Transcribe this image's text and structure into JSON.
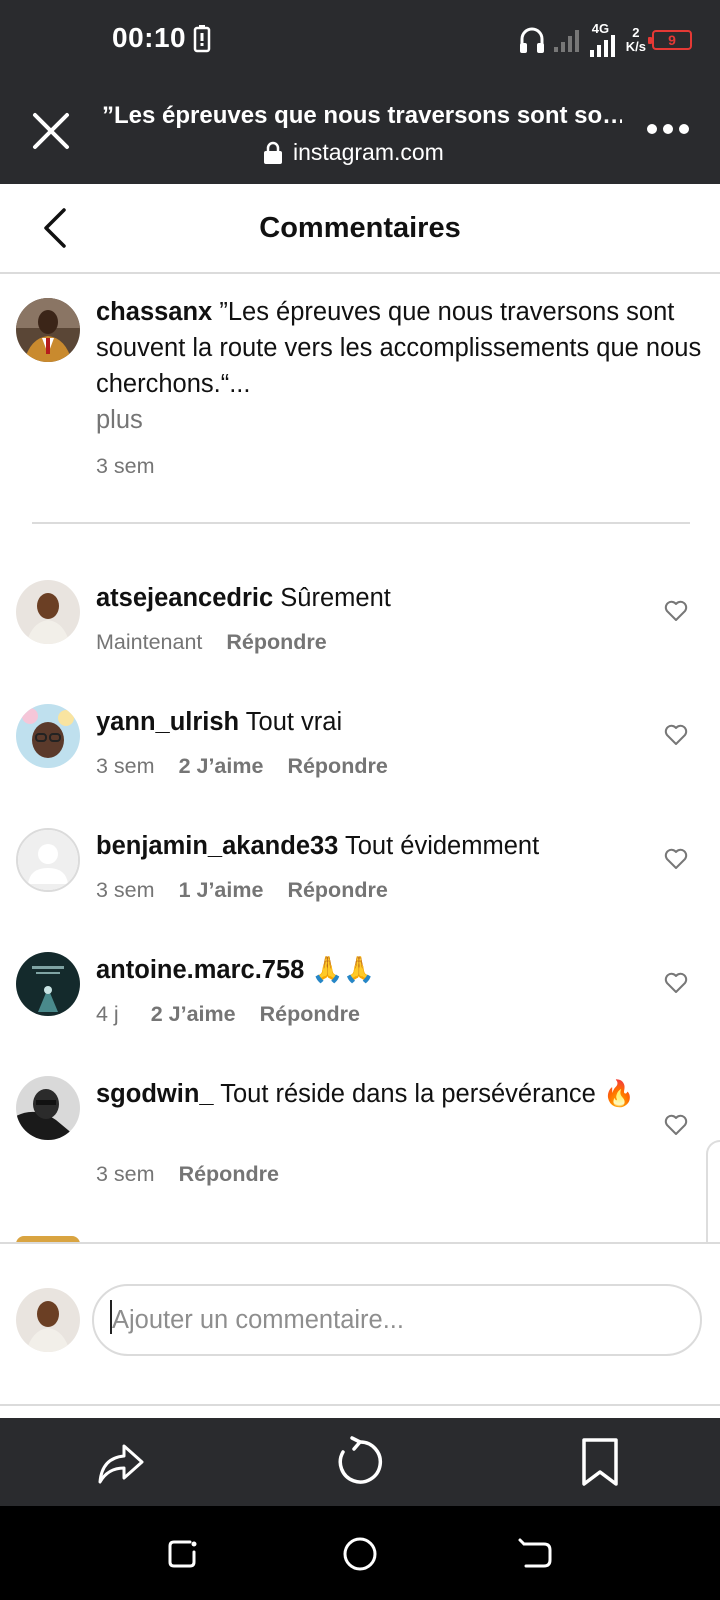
{
  "status_bar": {
    "time": "00:10",
    "network_top": "4G",
    "speed_value": "2",
    "speed_unit": "K/s",
    "battery": "9"
  },
  "browser": {
    "title": "”Les épreuves que nous traversons sont so…",
    "url": "instagram.com"
  },
  "header": {
    "title": "Commentaires"
  },
  "caption": {
    "username": "chassanx",
    "text": "”Les épreuves que nous traversons sont souvent la route vers les accomplissements que nous cherchons.“...",
    "more": "plus",
    "time": "3 sem"
  },
  "comments": [
    {
      "username": "atsejeancedric",
      "text": "Sûrement",
      "time": "Maintenant",
      "likes": "",
      "reply": "Répondre"
    },
    {
      "username": "yann_ulrish",
      "text": "Tout vrai",
      "time": "3 sem",
      "likes": "2 J’aime",
      "reply": "Répondre"
    },
    {
      "username": "benjamin_akande33",
      "text": "Tout évidemment",
      "time": "3 sem",
      "likes": "1 J’aime",
      "reply": "Répondre"
    },
    {
      "username": "antoine.marc.758",
      "text": "🙏🙏",
      "time": "4 j",
      "likes": "2 J’aime",
      "reply": "Répondre"
    },
    {
      "username": "sgodwin_",
      "text": "Tout réside dans la persévérance 🔥",
      "time": "3 sem",
      "likes": "",
      "reply": "Répondre"
    }
  ],
  "composer": {
    "placeholder": "Ajouter un commentaire..."
  },
  "colors": {
    "bar_bg": "#2a2b2e",
    "divider": "#dbdbdb",
    "muted_text": "#757575",
    "battery_low": "#e53935"
  },
  "icons": {
    "close": "close-icon",
    "lock": "lock-icon",
    "more": "more-dots-icon",
    "back": "chevron-left-icon",
    "heart": "heart-outline-icon",
    "share": "share-icon",
    "reload": "reload-icon",
    "bookmark": "bookmark-icon"
  }
}
